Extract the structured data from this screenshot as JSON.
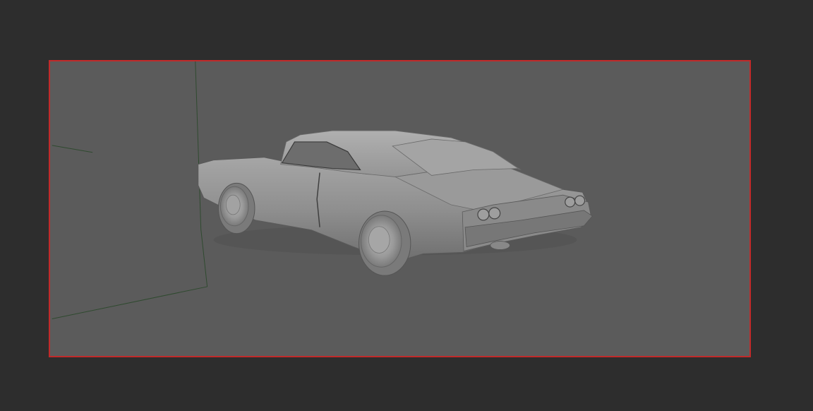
{
  "viewport": {
    "background": "#5b5b5b",
    "frame_color": "#c12a2a",
    "scene_object": "car-model"
  },
  "scene": {
    "grid_color": "#2c4a2c",
    "model_color": "#8e8e8e"
  }
}
